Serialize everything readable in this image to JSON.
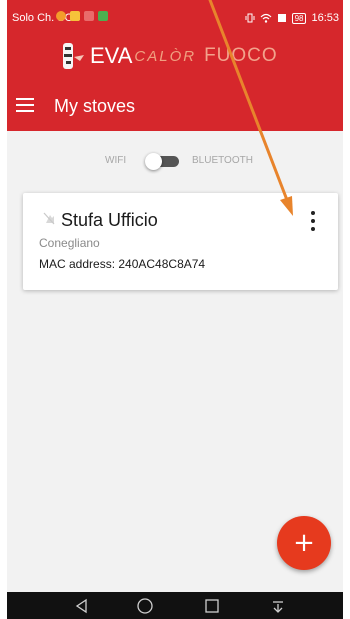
{
  "status_bar": {
    "carrier": "Solo Ch. SOS",
    "battery": "98",
    "time": "16:53"
  },
  "brand": {
    "eva": "EVA",
    "calor": "CALÒR",
    "fuoco": "FUOCO"
  },
  "toolbar": {
    "menu_icon": "menu-icon",
    "title": "My stoves"
  },
  "connection": {
    "wifi_label": "WIFI",
    "bluetooth_label": "BLUETOOTH",
    "selected": "bluetooth"
  },
  "stoves": [
    {
      "name": "Stufa Ufficio",
      "city": "Conegliano",
      "mac": "MAC address: 240AC48C8A74",
      "status_icon": "stove-off-icon",
      "menu_icon": "more-vert-icon"
    }
  ],
  "fab": {
    "label": "+",
    "icon": "add-icon"
  },
  "nav": {
    "back_icon": "back-icon",
    "home_icon": "home-icon",
    "recents_icon": "recents-icon",
    "notifications_icon": "notifications-down-icon"
  },
  "colors": {
    "header": "#d6272c",
    "background": "#f2f2f2",
    "fab": "#e63a1e",
    "annotation_arrow": "#e8842c"
  }
}
